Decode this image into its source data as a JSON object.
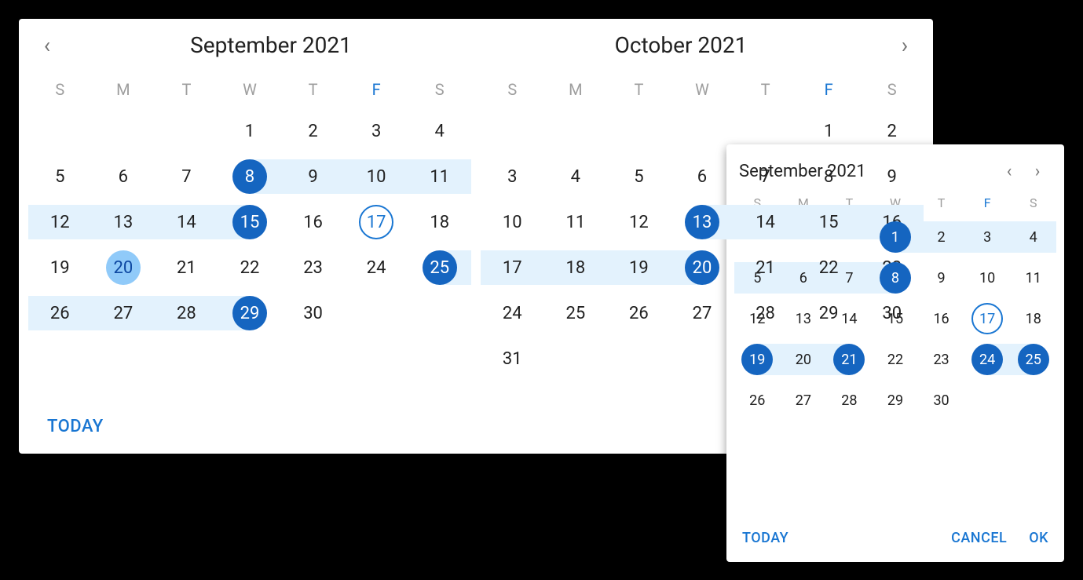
{
  "large_calendar": {
    "left": {
      "title": "September 2021",
      "dow": [
        "S",
        "M",
        "T",
        "W",
        "T",
        "F",
        "S"
      ],
      "friday_index": 5,
      "weeks": [
        [
          null,
          null,
          null,
          {
            "d": 1
          },
          {
            "d": 2
          },
          {
            "d": 3
          },
          {
            "d": 4
          }
        ],
        [
          {
            "d": 5
          },
          {
            "d": 6
          },
          {
            "d": 7
          },
          {
            "d": 8,
            "sel": true,
            "rs": true
          },
          {
            "d": 9,
            "rm": true
          },
          {
            "d": 10,
            "rm": true
          },
          {
            "d": 11,
            "rm": true
          }
        ],
        [
          {
            "d": 12,
            "rm": true
          },
          {
            "d": 13,
            "rm": true
          },
          {
            "d": 14,
            "rm": true
          },
          {
            "d": 15,
            "sel": true,
            "re": true
          },
          {
            "d": 16
          },
          {
            "d": 17,
            "today": true
          },
          {
            "d": 18
          }
        ],
        [
          {
            "d": 19
          },
          {
            "d": 20,
            "hover": true
          },
          {
            "d": 21
          },
          {
            "d": 22
          },
          {
            "d": 23
          },
          {
            "d": 24
          },
          {
            "d": 25,
            "sel": true,
            "rs": true
          }
        ],
        [
          {
            "d": 26,
            "rm": true
          },
          {
            "d": 27,
            "rm": true
          },
          {
            "d": 28,
            "rm": true
          },
          {
            "d": 29,
            "sel": true,
            "re": true
          },
          {
            "d": 30
          },
          null,
          null
        ]
      ]
    },
    "right": {
      "title": "October 2021",
      "dow": [
        "S",
        "M",
        "T",
        "W",
        "T",
        "F",
        "S"
      ],
      "friday_index": 5,
      "weeks": [
        [
          null,
          null,
          null,
          null,
          null,
          {
            "d": 1
          },
          {
            "d": 2
          }
        ],
        [
          {
            "d": 3
          },
          {
            "d": 4
          },
          {
            "d": 5
          },
          {
            "d": 6
          },
          {
            "d": 7
          },
          {
            "d": 8
          },
          {
            "d": 9
          }
        ],
        [
          {
            "d": 10
          },
          {
            "d": 11
          },
          {
            "d": 12
          },
          {
            "d": 13,
            "sel": true,
            "rs": true
          },
          {
            "d": 14,
            "rm": true
          },
          {
            "d": 15,
            "rm": true
          },
          {
            "d": 16,
            "rm": true
          }
        ],
        [
          {
            "d": 17,
            "rm": true
          },
          {
            "d": 18,
            "rm": true
          },
          {
            "d": 19,
            "rm": true
          },
          {
            "d": 20,
            "sel": true,
            "re": true
          },
          {
            "d": 21
          },
          {
            "d": 22
          },
          {
            "d": 23
          }
        ],
        [
          {
            "d": 24
          },
          {
            "d": 25
          },
          {
            "d": 26
          },
          {
            "d": 27
          },
          {
            "d": 28
          },
          {
            "d": 29
          },
          {
            "d": 30
          }
        ],
        [
          {
            "d": 31
          },
          null,
          null,
          null,
          null,
          null,
          null
        ]
      ]
    },
    "today_label": "TODAY"
  },
  "small_calendar": {
    "title": "September 2021",
    "dow": [
      "S",
      "M",
      "T",
      "W",
      "T",
      "F",
      "S"
    ],
    "friday_index": 5,
    "weeks": [
      [
        null,
        null,
        null,
        {
          "d": 1,
          "sel": true,
          "rs": true
        },
        {
          "d": 2,
          "rm": true
        },
        {
          "d": 3,
          "rm": true
        },
        {
          "d": 4,
          "rm": true
        }
      ],
      [
        {
          "d": 5,
          "rm": true
        },
        {
          "d": 6,
          "rm": true
        },
        {
          "d": 7,
          "rm": true
        },
        {
          "d": 8,
          "sel": true,
          "re": true
        },
        {
          "d": 9
        },
        {
          "d": 10
        },
        {
          "d": 11
        }
      ],
      [
        {
          "d": 12
        },
        {
          "d": 13
        },
        {
          "d": 14
        },
        {
          "d": 15
        },
        {
          "d": 16
        },
        {
          "d": 17,
          "today": true
        },
        {
          "d": 18
        }
      ],
      [
        {
          "d": 19,
          "sel": true,
          "rs": true
        },
        {
          "d": 20,
          "rm": true
        },
        {
          "d": 21,
          "sel": true,
          "re": true
        },
        {
          "d": 22
        },
        {
          "d": 23
        },
        {
          "d": 24,
          "sel": true,
          "rs": true
        },
        {
          "d": 25,
          "sel": true,
          "re": true
        }
      ],
      [
        {
          "d": 26
        },
        {
          "d": 27
        },
        {
          "d": 28
        },
        {
          "d": 29
        },
        {
          "d": 30
        },
        null,
        null
      ]
    ],
    "today_label": "TODAY",
    "cancel_label": "CANCEL",
    "ok_label": "OK"
  },
  "glyphs": {
    "chevron_left": "‹",
    "chevron_right": "›"
  }
}
